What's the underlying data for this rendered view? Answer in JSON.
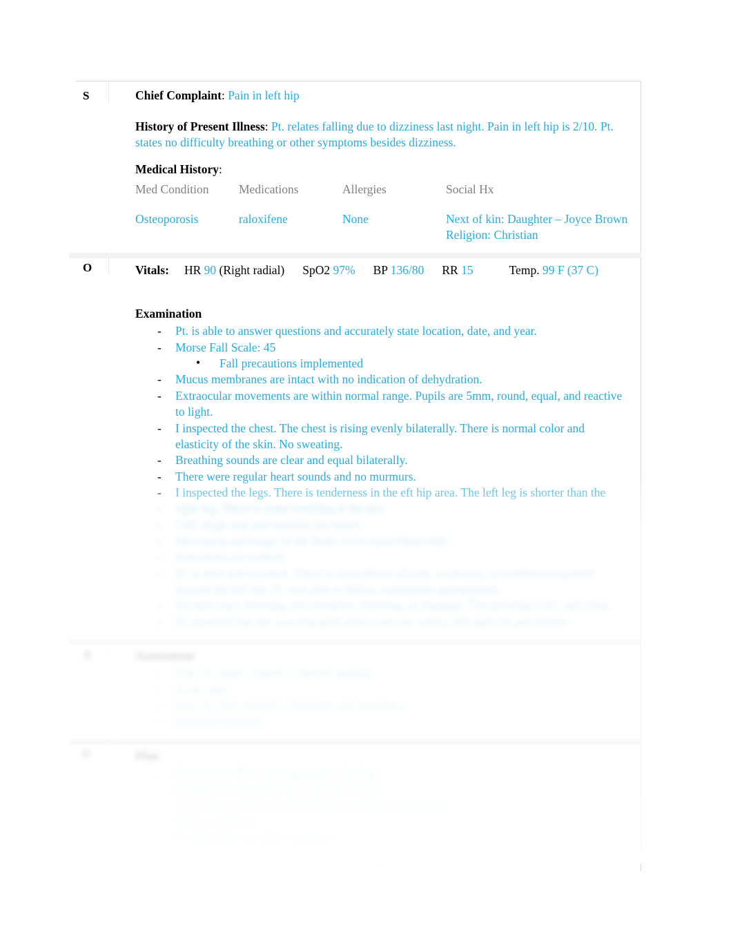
{
  "document": {
    "type": "SOAP nursing note"
  },
  "sections": {
    "subjective": {
      "letter": "S",
      "chief_complaint": {
        "label": "Chief Complaint",
        "separator": ": ",
        "value": "Pain in left hip"
      },
      "hpi": {
        "label": "History of Present Illness",
        "separator": ": ",
        "value": "Pt. relates falling due to dizziness last night. Pain in left hip is 2/10. Pt. states no difficulty breathing or other symptoms besides dizziness."
      },
      "medical_history": {
        "label": "Medical History",
        "separator": ":",
        "columns": [
          "Med Condition",
          "Medications",
          "Allergies",
          "Social Hx"
        ],
        "rows": [
          {
            "med_condition": "Osteoporosis",
            "medications": "raloxifene",
            "allergies": "None",
            "social_hx": [
              "Next of kin: Daughter – Joyce Brown",
              "Religion: Christian"
            ]
          }
        ]
      }
    },
    "objective": {
      "letter": "O",
      "vitals": {
        "label": "Vitals:",
        "items": [
          {
            "key": "HR",
            "value": "90",
            "suffix": "(Right radial)"
          },
          {
            "key": "SpO2",
            "value": "97%",
            "suffix": ""
          },
          {
            "key": "BP",
            "value": "136/80",
            "suffix": ""
          },
          {
            "key": "RR",
            "value": "15",
            "suffix": ""
          },
          {
            "key": "Temp.",
            "value": "99 F (37 C)",
            "suffix": ""
          }
        ]
      },
      "examination": {
        "heading": "Examination",
        "items": [
          {
            "text": "Pt. is able to answer questions and accurately state location, date, and year."
          },
          {
            "text": "Morse Fall Scale: 45",
            "sub": [
              "Fall precautions implemented"
            ]
          },
          {
            "text": "Mucus membranes are intact with no indication of dehydration."
          },
          {
            "text": "Extraocular movements are within normal range. Pupils are 5mm, round, equal, and reactive to light."
          },
          {
            "text": "I inspected the chest. The chest is rising evenly bilaterally. There is normal color and elasticity of the skin. No sweating."
          },
          {
            "text": "Breathing sounds are clear and equal bilaterally."
          },
          {
            "text": "There were regular heart sounds and no murmurs."
          },
          {
            "text": "I inspected the legs. There is tenderness in the eft hip area. The left leg is shorter than the"
          }
        ],
        "obscured_items": [
          {
            "text": "right leg. There is some swelling at the site."
          },
          {
            "text": "Calf, thigh and arm muscles are intact."
          },
          {
            "text": "Movement and range of the limbs were equal bilaterally."
          },
          {
            "text": "Sensations are normal."
          },
          {
            "text": "Pt. is alert and oriented. There is no evidence of pain, weakness, or numbness reported beyond the left hip. Pt. was able to follow commands appropriately."
          },
          {
            "text": "No skin tears, bruising, discoloration, bleeding, or drainage. The dressing is dry and clean."
          },
          {
            "text": "Pt. reported that she was educated about exercise, safety, diet and risk prevention."
          }
        ]
      }
    },
    "assessment": {
      "letter": "A",
      "heading": "Assessment",
      "obscured_items": [
        {
          "text": "Risk for injury related to altered mobility."
        },
        {
          "text": "Acute pain."
        },
        {
          "text": "Risk for falls related to dizziness and weakness."
        },
        {
          "text": "Impaired mobility."
        }
      ]
    },
    "plan": {
      "letter": "P",
      "heading": "Plan",
      "obscured_items": [
        {
          "text": "Reported to RN. Awaiting orders. Pending."
        },
        {
          "text": "Continue to monitor vitals and pain levels."
        },
        {
          "text": "Assist the patient with ambulation, transfers and activity."
        },
        {
          "text": "Fall precautions."
        },
        {
          "text": "Pt. education on safety measures."
        },
        {
          "text": "Schedule follow-up with the ordered imaging and therapy."
        }
      ]
    }
  },
  "colors": {
    "accent_blue": "#29ABE2",
    "muted_gray": "#808080",
    "text_black": "#000000",
    "border_gray": "#d9d9d9",
    "band_gray": "#f2f2f2"
  }
}
